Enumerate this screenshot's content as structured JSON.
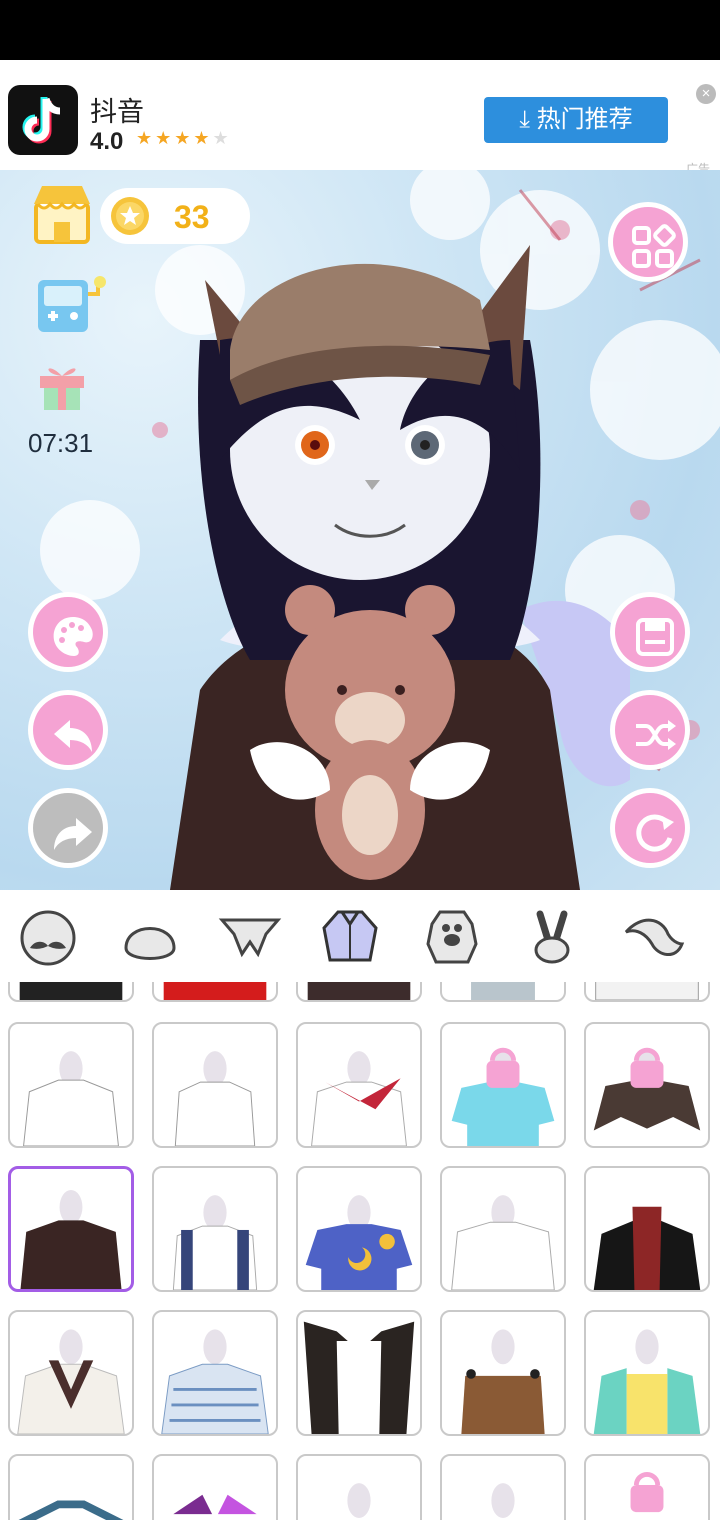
{
  "ad": {
    "app_name": "抖音",
    "rating": "4.0",
    "stars_filled": 4,
    "stars_total": 5,
    "button_label": "热门推荐",
    "ad_label": "广告"
  },
  "hud": {
    "coins": "33",
    "timer": "07:31"
  },
  "icons": {
    "shop": "shop-icon",
    "coin": "coin-icon",
    "game": "game-console-icon",
    "gift": "gift-icon",
    "menu": "grid-menu-icon",
    "palette": "palette-icon",
    "undo": "undo-icon",
    "redo": "redo-icon",
    "save": "save-icon",
    "shuffle": "shuffle-icon",
    "reset": "refresh-icon"
  },
  "tabs": [
    {
      "name": "tab-mustache-head",
      "active": false
    },
    {
      "name": "tab-head",
      "active": false
    },
    {
      "name": "tab-wings",
      "active": false
    },
    {
      "name": "tab-clothes",
      "active": true
    },
    {
      "name": "tab-paw",
      "active": false
    },
    {
      "name": "tab-gesture",
      "active": false
    },
    {
      "name": "tab-tail",
      "active": false
    }
  ],
  "colors": {
    "accent_pink": "#f5a3d3",
    "coin_yellow": "#f2b118",
    "selected_border": "#a35de6",
    "ad_button": "#2d8fdd",
    "star": "#f5a623"
  }
}
